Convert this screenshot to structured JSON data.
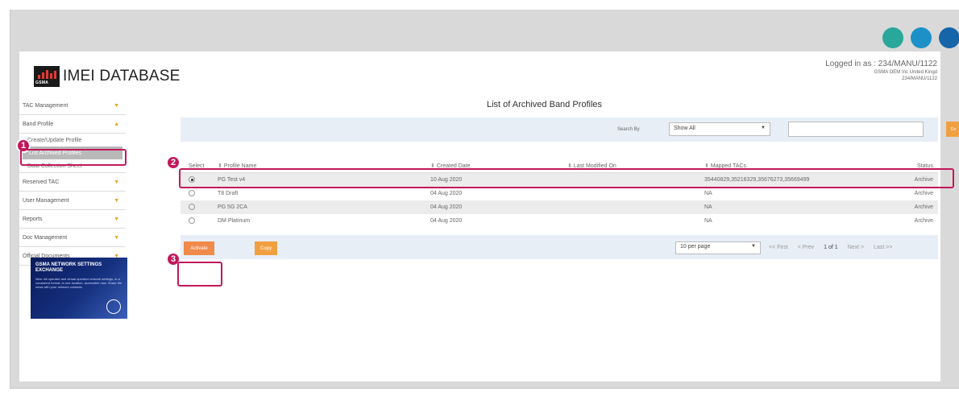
{
  "window": {
    "dot_colors": [
      "#2aa79b",
      "#1e90c8",
      "#1565a8"
    ]
  },
  "header": {
    "logo_badge": "GSMA",
    "logo_text": "IMEI DATABASE",
    "login_line1": "Logged in as : 234/MANU/1122",
    "login_line2": "GSMA OEM Inc United Kingd",
    "login_line3": "234/MANU/1122"
  },
  "sidebar": {
    "items": [
      {
        "label": "TAC Management",
        "expanded": false
      },
      {
        "label": "Band Profile",
        "expanded": true,
        "sub": [
          "Create/Update Profile",
          "List Archived Profiles",
          "Data Collection Sheet"
        ]
      },
      {
        "label": "Reserved TAC",
        "expanded": false
      },
      {
        "label": "User Management",
        "expanded": false
      },
      {
        "label": "Reports",
        "expanded": false
      },
      {
        "label": "Doc Management",
        "expanded": false
      },
      {
        "label": "Official Documents",
        "expanded": false
      }
    ],
    "promo_title": "GSMA NETWORK SETTINGS EXCHANGE",
    "promo_body": "New: All operator and virtual operator network settings, in a consistent format, in one location, accessible now. Share the news with your network contacts."
  },
  "main": {
    "title": "List of Archived Band Profiles",
    "search_label": "Search By",
    "search_select": "Show All",
    "search_value": "",
    "go_label": "Go",
    "columns": [
      "Select",
      "Profile Name",
      "Created Date",
      "Last Modified On",
      "Mapped TACs",
      "Status"
    ],
    "rows": [
      {
        "selected": true,
        "name": "PG Test v4",
        "created": "10 Aug 2020",
        "modified": "",
        "tacs": "35440829,35216329,35676273,35669499",
        "status": "Archive"
      },
      {
        "selected": false,
        "name": "T8 Draft",
        "created": "04 Aug 2020",
        "modified": "",
        "tacs": "NA",
        "status": "Archive"
      },
      {
        "selected": false,
        "name": "PG 5G 2CA",
        "created": "04 Aug 2020",
        "modified": "",
        "tacs": "NA",
        "status": "Archive"
      },
      {
        "selected": false,
        "name": "DM Platinum",
        "created": "04 Aug 2020",
        "modified": "",
        "tacs": "NA",
        "status": "Archive"
      }
    ],
    "activate_label": "Activate",
    "copy_label": "Copy",
    "per_page": "10 per page",
    "pager": {
      "first": "<< First",
      "prev": "< Prev",
      "current": "1 of 1",
      "next": "Next >",
      "last": "Last >>"
    }
  },
  "annotations": {
    "step1": "1",
    "step2": "2",
    "step3": "3",
    "color": "#c2185b"
  }
}
